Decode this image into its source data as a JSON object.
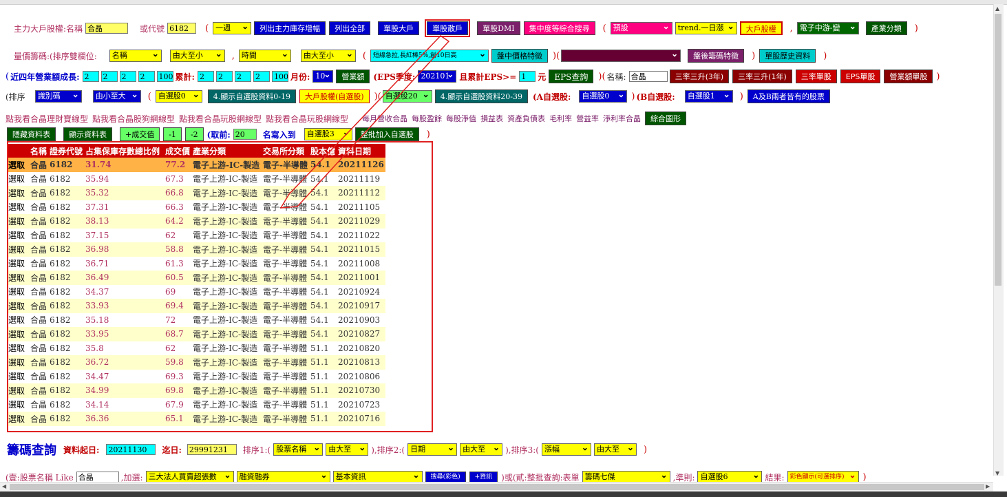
{
  "row1": {
    "label_main": "主力大戶股權:名稱",
    "name_value": "合晶",
    "label_code": "或代號",
    "code_value": "6182",
    "period_select": "一週",
    "btn_list_inc": "列出主力庫存增幅",
    "btn_list_all": "列出全部",
    "btn_single_big": "單股大戶",
    "btn_single_count": "單股散戶",
    "btn_dmi": "單股DMI",
    "btn_concentration": "集中度等綜合搜尋",
    "preset_select": "預設",
    "trend_select": "trend.一日漲",
    "btn_big_holder": "大戶股權",
    "comma": ",",
    "industry_select": "電子中游-變",
    "btn_industry": "產業分類"
  },
  "row2": {
    "label": "量價籌碼:(排序雙欄位:",
    "sort1_select": "名稱",
    "order1_select": "由大至小",
    "comma": ",",
    "sort2_select": "時間",
    "order2_select": "由大至小",
    "pattern_select": "短線急拉,長紅棒5%,創10日高",
    "btn_price": "盤中價格特徵",
    "dark_select": "",
    "btn_after": "盤後籌碼特徵",
    "btn_history": "單股歷史資料"
  },
  "row3": {
    "label_growth": "近四年營業額成長:",
    "growth_inputs": [
      "2",
      "2",
      "2",
      "2",
      "100"
    ],
    "label_cum": "累計:",
    "cum_inputs": [
      "2",
      "2",
      "2",
      "2",
      "100"
    ],
    "label_month": "月份:",
    "month_select": "10",
    "btn_revenue": "營業額",
    "label_eps": "(EPS季度:",
    "eps_select": "202101",
    "label_eps_cum": "且累計EPS>=",
    "eps_value": "1",
    "label_yuan": "元",
    "btn_eps": "EPS查詢",
    "label_name": "名稱:",
    "name_value": "合晶",
    "btn_three3": "三率三升(3年)",
    "btn_three1": "三率三升(1年)",
    "btn_three_single": "三率單股",
    "btn_eps_single": "EPS單股",
    "btn_rev_single": "營業額單股"
  },
  "row4": {
    "label_sort": "(排序",
    "code_select": "識別碼",
    "order_select": "由小至大",
    "fav0_select": "自選股0",
    "btn_show0": "4.顯示自選股資料0-19",
    "btn_big_fav": "大戶股權(自選股)",
    "fav20_select": "自選股20",
    "btn_show20": "4.顯示自選股資料20-39",
    "label_a": "(A自選股:",
    "a_select": "自選股0",
    "label_b": "(B自選股:",
    "b_select": "自選股1",
    "btn_ab": "A及B兩者皆有的股票"
  },
  "row5": {
    "links_main": [
      "點我看合晶理財寶線型",
      "點我看合晶股狗網線型",
      "點我看合晶玩股網線型",
      "點我看合晶玩股網線型"
    ],
    "links_sub": [
      "每月營收合晶",
      "每股盈餘",
      "每股淨值",
      "損益表",
      "資產負債表",
      "毛利率",
      "營益率",
      "淨利率合晶"
    ],
    "btn_chart": "綜合圖形"
  },
  "row6": {
    "btn_hide": "隱藏資料表",
    "btn_show": "顯示資料表",
    "btn_plus_vol": "+成交值",
    "btn_m1": "-1",
    "btn_m2": "-2",
    "label_take": "(取前:",
    "take_value": "20",
    "label_write": "名寫入到",
    "fav3_select": "自選股3",
    "btn_batch": "整批加入自選股"
  },
  "table": {
    "headers": [
      "名稱",
      "證券代號",
      "占集保庫存數總比例",
      "成交價",
      "產業分類",
      "交易所分類",
      "股本億",
      "資料日期"
    ],
    "select_label": "選取",
    "rows": [
      [
        "合晶",
        "6182",
        "31.74",
        "77.2",
        "電子上游-IC-製造",
        "電子-半導體",
        "54.1",
        "20211126"
      ],
      [
        "合晶",
        "6182",
        "35.94",
        "67.3",
        "電子上游-IC-製造",
        "電子-半導體",
        "54.1",
        "20211119"
      ],
      [
        "合晶",
        "6182",
        "35.32",
        "66.8",
        "電子上游-IC-製造",
        "電子-半導體",
        "54.1",
        "20211112"
      ],
      [
        "合晶",
        "6182",
        "37.31",
        "66.3",
        "電子上游-IC-製造",
        "電子-半導體",
        "54.1",
        "20211105"
      ],
      [
        "合晶",
        "6182",
        "38.13",
        "64.2",
        "電子上游-IC-製造",
        "電子-半導體",
        "54.1",
        "20211029"
      ],
      [
        "合晶",
        "6182",
        "37.15",
        "62",
        "電子上游-IC-製造",
        "電子-半導體",
        "54.1",
        "20211022"
      ],
      [
        "合晶",
        "6182",
        "36.98",
        "58.8",
        "電子上游-IC-製造",
        "電子-半導體",
        "54.1",
        "20211015"
      ],
      [
        "合晶",
        "6182",
        "36.71",
        "61.3",
        "電子上游-IC-製造",
        "電子-半導體",
        "54.1",
        "20211008"
      ],
      [
        "合晶",
        "6182",
        "36.49",
        "60.5",
        "電子上游-IC-製造",
        "電子-半導體",
        "54.1",
        "20211001"
      ],
      [
        "合晶",
        "6182",
        "34.37",
        "69",
        "電子上游-IC-製造",
        "電子-半導體",
        "54.1",
        "20210924"
      ],
      [
        "合晶",
        "6182",
        "33.93",
        "69.4",
        "電子上游-IC-製造",
        "電子-半導體",
        "54.1",
        "20210917"
      ],
      [
        "合晶",
        "6182",
        "35.18",
        "72",
        "電子上游-IC-製造",
        "電子-半導體",
        "54.1",
        "20210903"
      ],
      [
        "合晶",
        "6182",
        "33.95",
        "68.7",
        "電子上游-IC-製造",
        "電子-半導體",
        "54.1",
        "20210827"
      ],
      [
        "合晶",
        "6182",
        "35.8",
        "62",
        "電子上游-IC-製造",
        "電子-半導體",
        "51.1",
        "20210820"
      ],
      [
        "合晶",
        "6182",
        "36.72",
        "59.8",
        "電子上游-IC-製造",
        "電子-半導體",
        "51.1",
        "20210813"
      ],
      [
        "合晶",
        "6182",
        "34.47",
        "69.3",
        "電子上游-IC-製造",
        "電子-半導體",
        "51.1",
        "20210806"
      ],
      [
        "合晶",
        "6182",
        "34.99",
        "69.8",
        "電子上游-IC-製造",
        "電子-半導體",
        "51.1",
        "20210730"
      ],
      [
        "合晶",
        "6182",
        "34.14",
        "67.9",
        "電子上游-IC-製造",
        "電子-半導體",
        "51.1",
        "20210723"
      ],
      [
        "合晶",
        "6182",
        "36.36",
        "65.1",
        "電子上游-IC-製造",
        "電子-半導體",
        "51.1",
        "20210716"
      ]
    ]
  },
  "chip": {
    "title": "籌碼查詢",
    "label_start": "資料起日:",
    "start_value": "20211130",
    "label_end": "迄日:",
    "end_value": "29991231",
    "label_sort1": "排序1:(",
    "sort1_select": "股票名稱",
    "order1_select": "由大至",
    "label_sort2": "),排序2:(",
    "sort2_select": "日期",
    "order2_select": "由大至",
    "label_sort3": "),排序3:(",
    "sort3_select": "漲幅",
    "order3_select": "由大至"
  },
  "bottom": {
    "label_one": "(壹:股票名稱 Like",
    "name_value": "合晶",
    "label_add": ",加選:",
    "add_select": "三大法人買賣超張數",
    "margin_select": "融資融券",
    "basic_select": "基本資訊",
    "btn_search_color": "搜尋(彩色)",
    "btn_plus_info": "+資訊",
    "label_two": ")或(貳:整批查詢:表單",
    "form_select": "籌碼七傑",
    "label_rule": ",準則:",
    "rule_select": "自選股6",
    "label_result": "結果:",
    "result_select": "彩色顯示(可選排序)"
  }
}
